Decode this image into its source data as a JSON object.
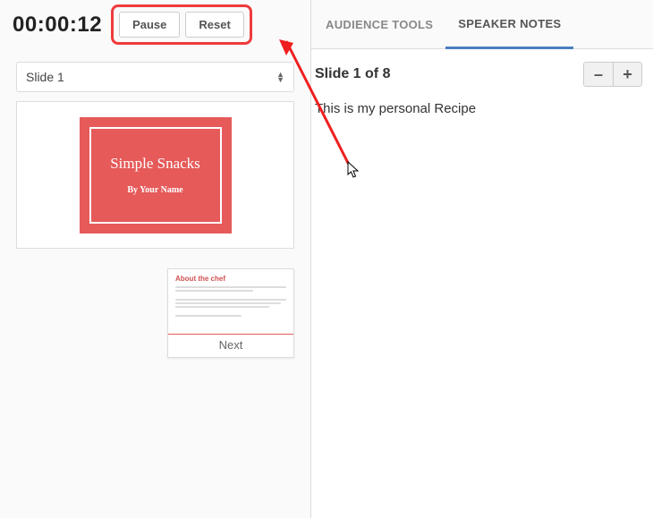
{
  "timer": {
    "value": "00:00:12",
    "pause_label": "Pause",
    "reset_label": "Reset"
  },
  "slide_selector": {
    "current": "Slide 1"
  },
  "current_slide": {
    "title": "Simple Snacks",
    "subtitle": "By Your Name"
  },
  "next_slide": {
    "heading": "About the chef",
    "label": "Next"
  },
  "tabs": {
    "audience": "AUDIENCE TOOLS",
    "speaker": "SPEAKER NOTES"
  },
  "notes": {
    "heading": "Slide 1 of 8",
    "body": "This is my personal Recipe"
  },
  "zoom": {
    "minus": "–",
    "plus": "+"
  }
}
